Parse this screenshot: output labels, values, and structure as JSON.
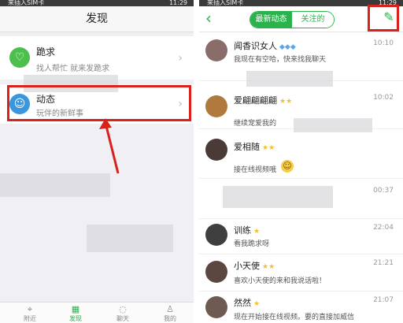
{
  "left": {
    "status": {
      "carrier": "来插入SIM卡",
      "time": "11:29"
    },
    "title": "发现",
    "items": [
      {
        "title": "跪求",
        "subtitle": "找人帮忙 就来发跪求",
        "icon": "heart-icon"
      },
      {
        "title": "动态",
        "subtitle": "玩伴的新鲜事",
        "icon": "people-icon"
      }
    ],
    "tabs": [
      {
        "label": "附近",
        "icon": "location-icon"
      },
      {
        "label": "发现",
        "icon": "grid-icon"
      },
      {
        "label": "聊天",
        "icon": "chat-icon"
      },
      {
        "label": "我的",
        "icon": "person-icon"
      }
    ]
  },
  "right": {
    "status": {
      "carrier": "来插入SIM卡",
      "time": "11:29"
    },
    "segments": [
      "最新动态",
      "关注的"
    ],
    "feed": [
      {
        "name": "闻香识女人",
        "badge": "◆◆◆",
        "message": "我现在有空哈，快来找我聊天",
        "time": "10:10"
      },
      {
        "name": "爱翩翩翩翩",
        "badge": "★★",
        "message": "继续宠爱我的",
        "time": "10:02"
      },
      {
        "name": "爱相随",
        "badge": "★★",
        "message": "接在线视频哦",
        "time": ""
      },
      {
        "name": "",
        "badge": "",
        "message": "",
        "time": "00:37"
      },
      {
        "name": "训练",
        "badge": "★",
        "message": "看我跪求呀",
        "time": "22:04"
      },
      {
        "name": "小天使",
        "badge": "★★",
        "message": "喜欢小天使的来和我说话啦！",
        "time": "21:21"
      },
      {
        "name": "然然",
        "badge": "★",
        "message": "现在开始接在线视频。要的直接加威信",
        "time": "21:07"
      }
    ]
  },
  "colors": {
    "accent": "#2bb24c",
    "annotation": "#d9221c"
  }
}
